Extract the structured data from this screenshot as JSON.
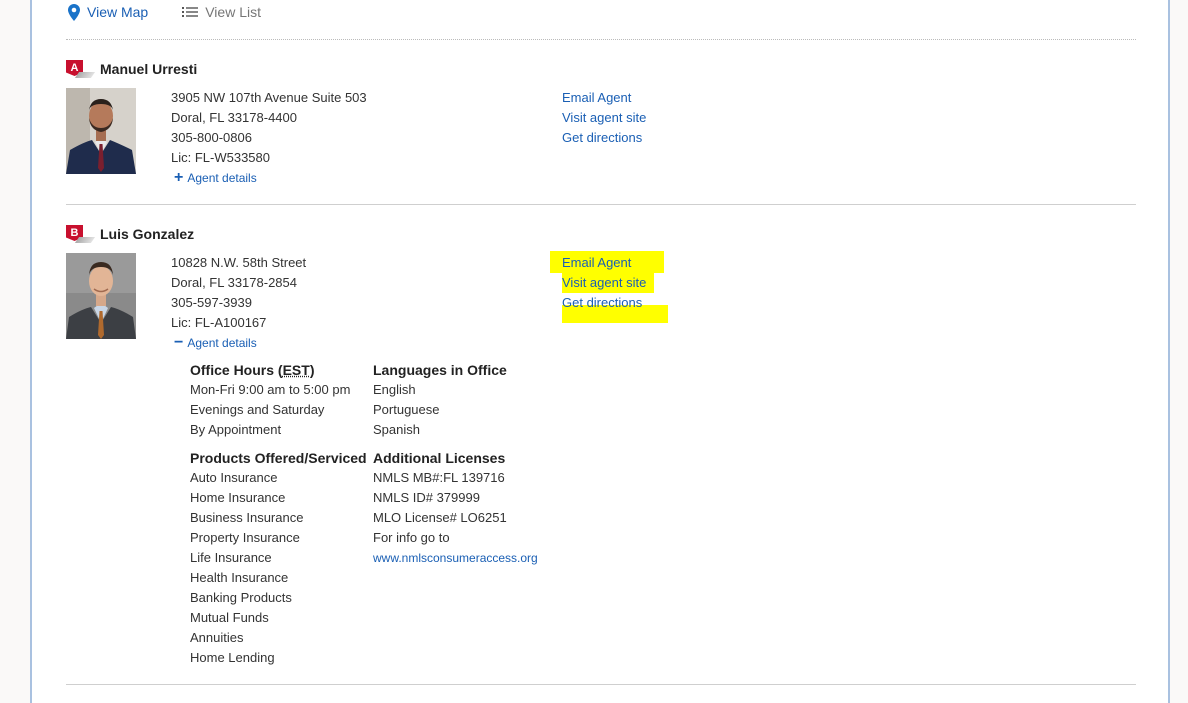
{
  "view_toggle": {
    "map_label": "View Map",
    "list_label": "View List"
  },
  "agents": [
    {
      "marker": "A",
      "name": "Manuel Urresti",
      "address": [
        "3905 NW 107th Avenue Suite 503",
        "Doral,  FL  33178-4400",
        "305-800-0806",
        "Lic: FL-W533580"
      ],
      "details_label": "Agent details",
      "actions": {
        "email": "Email Agent",
        "site": "Visit agent site",
        "directions": "Get directions"
      }
    },
    {
      "marker": "B",
      "name": "Luis Gonzalez",
      "address": [
        "10828 N.W. 58th Street",
        "Doral,  FL  33178-2854",
        "305-597-3939",
        "Lic: FL-A100167"
      ],
      "details_label": "Agent details",
      "actions": {
        "email": "Email Agent",
        "site": "Visit agent site",
        "directions": "Get directions"
      },
      "details": {
        "office_hours": {
          "title_prefix": "Office Hours (",
          "tz": "EST",
          "title_suffix": ")",
          "lines": [
            "Mon-Fri 9:00 am to 5:00 pm",
            "Evenings and Saturday",
            "By Appointment"
          ]
        },
        "languages": {
          "title": "Languages in Office",
          "lines": [
            "English",
            "Portuguese",
            "Spanish"
          ]
        },
        "products": {
          "title": "Products Offered/Serviced",
          "lines": [
            "Auto Insurance",
            "Home Insurance",
            "Business Insurance",
            "Property Insurance",
            "Life Insurance",
            "Health Insurance",
            "Banking Products",
            "Mutual Funds",
            "Annuities",
            "Home Lending"
          ]
        },
        "licenses": {
          "title": "Additional Licenses",
          "lines": [
            "NMLS MB#:FL 139716",
            "NMLS ID# 379999",
            "MLO License# LO6251",
            "For info go to"
          ],
          "link": "www.nmlsconsumeraccess.org"
        }
      }
    }
  ],
  "colors": {
    "link": "#1a5fb4",
    "marker": "#c8102e",
    "highlight": "#ffff00",
    "panel_border": "#a9c1e0"
  },
  "icons": {
    "map": "map-pin-icon",
    "list": "list-icon",
    "expand": "plus-icon",
    "collapse": "minus-icon"
  }
}
